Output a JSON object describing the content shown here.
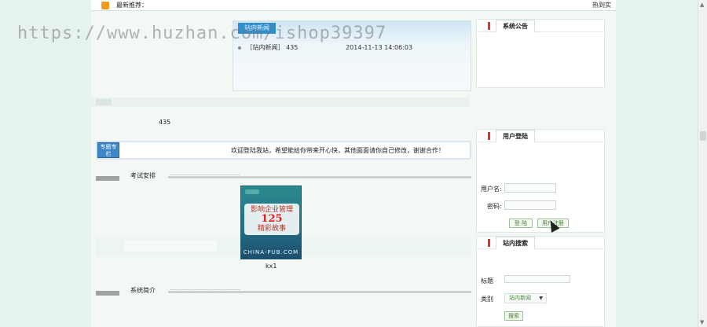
{
  "watermark": "https://www.huzhan.com/ishop39397",
  "topbar": {
    "label": "最新推荐：",
    "right_label": "热到实"
  },
  "news": {
    "tab_label": "站内新闻",
    "items": [
      {
        "title": "［站内新闻］ 435",
        "date": "2014-11-13 14:06:03"
      }
    ]
  },
  "count_label": "435",
  "special": {
    "tag": "专题专栏",
    "message": "欢迎登陆我站，希望能给你带来开心快，其他面面请你自己修改，谢谢合作！"
  },
  "sections": {
    "exam": {
      "title": "考试安排",
      "line_label": "——————————————————"
    },
    "intro": {
      "title": "系统简介",
      "line_label": "——————————————————"
    }
  },
  "book": {
    "cover_line1": "影响企业管理",
    "cover_big": "125",
    "cover_line2": "精彩故事",
    "footer": "CHINA-PUB.COM",
    "caption": "kx1"
  },
  "right": {
    "announcement_title": "系统公告",
    "login_title": "用户登陆",
    "username_label": "用户名:",
    "password_label": "密码:",
    "login_button": "登 陆",
    "register_button": "用户注册",
    "search_title": "站内搜索",
    "search_label": "标题",
    "category_label": "类别",
    "category_value": "站内新闻",
    "search_button": "搜索"
  }
}
